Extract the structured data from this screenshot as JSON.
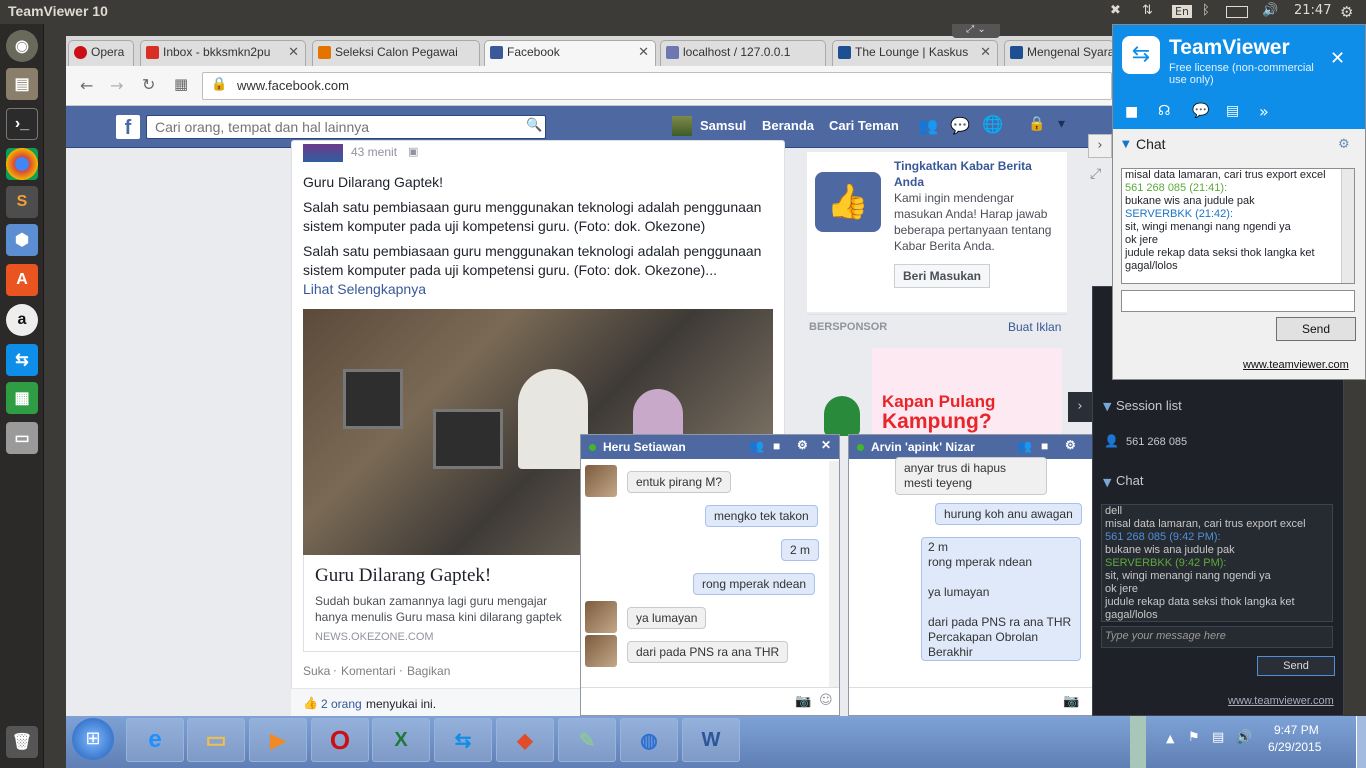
{
  "topbar": {
    "title": "TeamViewer 10",
    "lang": "En",
    "time": "21:47"
  },
  "launcher": {
    "items": [
      "ubuntu-dash",
      "files",
      "terminal",
      "chrome",
      "sublime",
      "virtualbox",
      "software-center",
      "amazon",
      "teamviewer",
      "spreadsheet",
      "drive",
      "trash"
    ]
  },
  "browser": {
    "tabs": [
      {
        "label": "Opera",
        "color": "#cc0f16"
      },
      {
        "label": "Inbox - bkksmkn2pu",
        "color": "#d93025"
      },
      {
        "label": "Seleksi Calon Pegawai",
        "color": "#e37400"
      },
      {
        "label": "Facebook",
        "color": "#3b5998",
        "active": true
      },
      {
        "label": "localhost / 127.0.0.1",
        "color": "#6c78af"
      },
      {
        "label": "The Lounge | Kaskus",
        "color": "#1d4f91"
      },
      {
        "label": "Mengenal Syara",
        "color": "#1d4f91"
      }
    ],
    "url": "www.facebook.com"
  },
  "facebook": {
    "search_placeholder": "Cari orang, tempat dan hal lainnya",
    "nav": {
      "profile": "Samsul",
      "home": "Beranda",
      "find_friends": "Cari Teman"
    },
    "post": {
      "time": "43 menit",
      "title": "Guru Dilarang Gaptek!",
      "p1": "Salah satu pembiasaan guru menggunakan teknologi adalah penggunaan sistem komputer pada uji kompetensi guru. (Foto: dok. Okezone)",
      "p2": "Salah satu pembiasaan guru menggunakan teknologi adalah penggunaan sistem komputer pada uji kompetensi guru. (Foto: dok. Okezone)...",
      "see_more": "Lihat Selengkapnya",
      "card_title": "Guru Dilarang Gaptek!",
      "card_desc": "Sudah bukan zamannya lagi guru mengajar hanya menulis Guru masa kini dilarang gaptek",
      "card_source": "NEWS.OKEZONE.COM",
      "actions": {
        "like": "Suka",
        "comment": "Komentari",
        "share": "Bagikan"
      },
      "likes": "2 orang",
      "likes_suffix": "menyukai ini."
    },
    "promo": {
      "title": "Tingkatkan Kabar Berita Anda",
      "body": "Kami ingin mendengar masukan Anda! Harap jawab beberapa pertanyaan tentang Kabar Berita Anda.",
      "button": "Beri Masukan"
    },
    "sponsored": {
      "label": "BERSPONSOR",
      "create_ad": "Buat Iklan",
      "ad_line1": "Kapan Pulang",
      "ad_line2": "Kampung?"
    }
  },
  "chats": [
    {
      "name": "Heru Setiawan",
      "messages": [
        {
          "text": "entuk pirang M?",
          "me": false
        },
        {
          "text": "mengko tek takon",
          "me": true
        },
        {
          "text": "2 m",
          "me": true
        },
        {
          "text": "rong mperak ndean",
          "me": true
        },
        {
          "text": "ya lumayan",
          "me": false
        },
        {
          "text": "dari pada PNS ra ana THR",
          "me": false
        }
      ]
    },
    {
      "name": "Arvin 'apink' Nizar",
      "messages": [
        {
          "text": "anyar trus di hapus mesti teyeng",
          "me": false
        },
        {
          "text": "hurung koh anu awagan",
          "me": true
        },
        {
          "text": "2 m",
          "me": true
        },
        {
          "text": "rong mperak ndean",
          "me": true
        },
        {
          "text": "ya lumayan",
          "me": true
        },
        {
          "text": "dari pada PNS ra ana THR",
          "me": true
        },
        {
          "text": "Percakapan Obrolan Berakhir",
          "me": true
        }
      ]
    }
  ],
  "teamviewer": {
    "brand": "TeamViewer",
    "license": "Free license (non-commercial use only)",
    "chat_label": "Chat",
    "log": [
      {
        "text": "misal data lamaran, cari trus export excel",
        "kind": "msg"
      },
      {
        "text": "561 268 085 (21:41):",
        "kind": "green"
      },
      {
        "text": "bukane wis ana judule pak",
        "kind": "msg"
      },
      {
        "text": "SERVERBKK (21:42):",
        "kind": "blue"
      },
      {
        "text": "sit, wingi menangi nang ngendi ya",
        "kind": "msg"
      },
      {
        "text": "ok jere",
        "kind": "msg"
      },
      {
        "text": "judule rekap data seksi thok langka ket gagal/lolos",
        "kind": "msg"
      }
    ],
    "send": "Send",
    "link": "www.teamviewer.com"
  },
  "teamviewer_panel": {
    "session_list": "Session list",
    "session_id": "561 268 085",
    "chat_label": "Chat",
    "log": [
      {
        "text": "dell",
        "kind": "msg"
      },
      {
        "text": "misal data lamaran, cari trus export excel",
        "kind": "msg"
      },
      {
        "text": "561 268 085 (9:42 PM):",
        "kind": "blue"
      },
      {
        "text": "bukane wis ana judule pak",
        "kind": "msg"
      },
      {
        "text": "SERVERBKK (9:42 PM):",
        "kind": "green"
      },
      {
        "text": "sit, wingi menangi nang ngendi ya",
        "kind": "msg"
      },
      {
        "text": "ok jere",
        "kind": "msg"
      },
      {
        "text": "judule rekap data seksi thok langka ket gagal/lolos",
        "kind": "msg"
      }
    ],
    "placeholder": "Type your message here",
    "send": "Send",
    "link": "www.teamviewer.com"
  },
  "taskbar": {
    "time": "9:47 PM",
    "date": "6/29/2015",
    "apps": [
      "ie",
      "explorer",
      "media",
      "opera",
      "excel",
      "teamviewer",
      "git",
      "notepad",
      "network",
      "word"
    ]
  }
}
